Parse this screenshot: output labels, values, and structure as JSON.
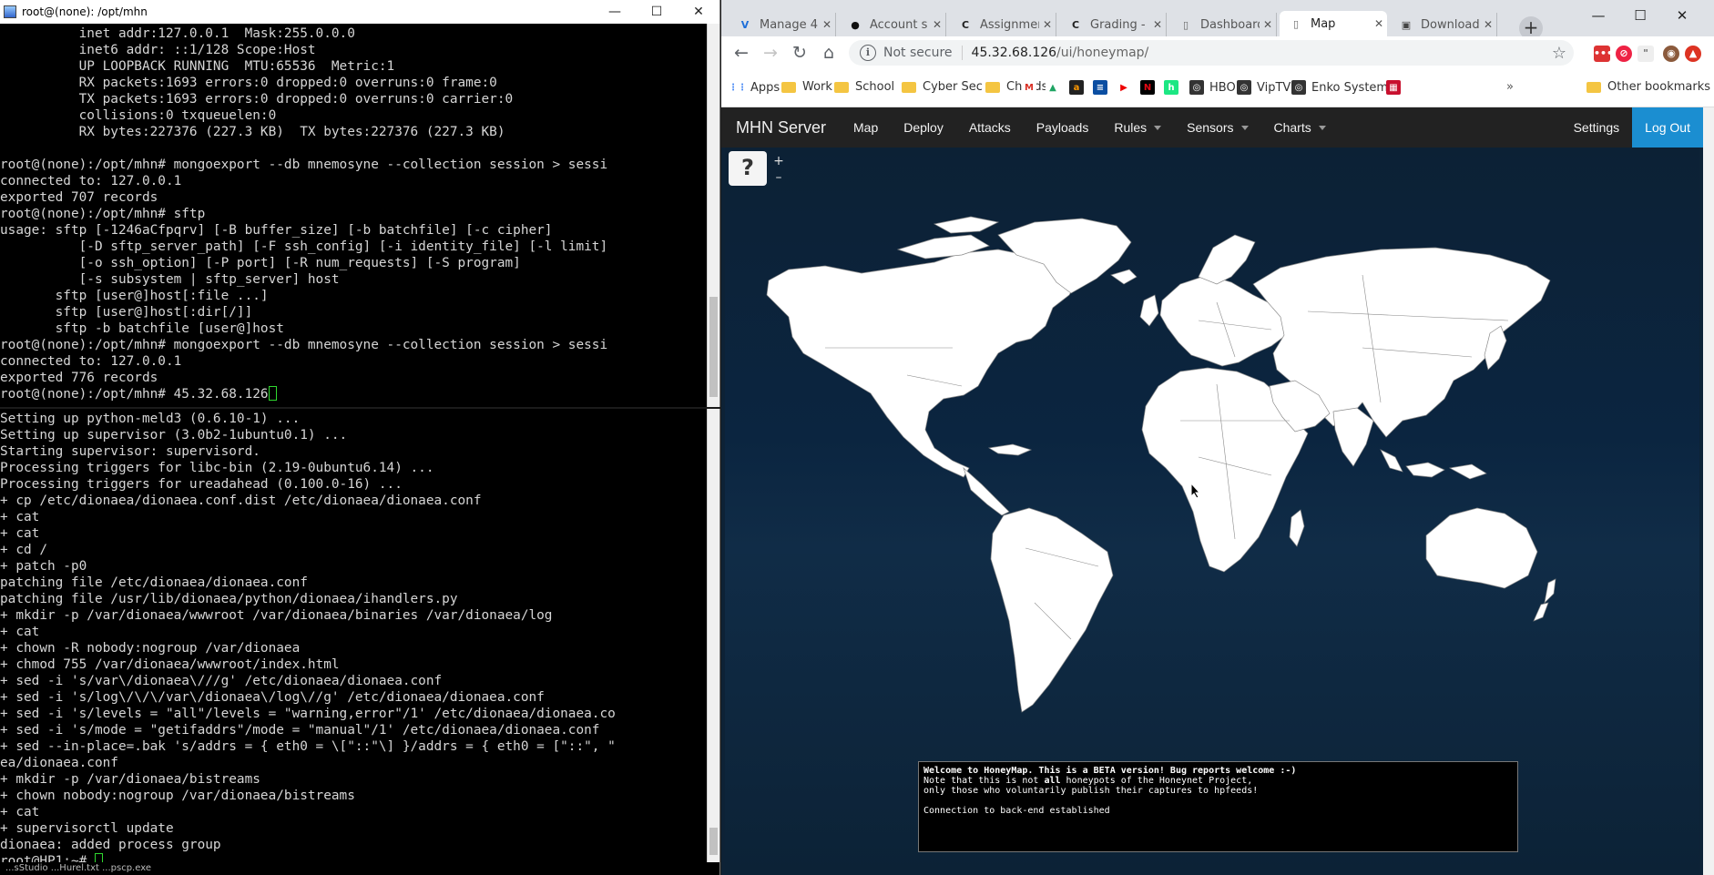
{
  "terminal_top": {
    "title": "root@(none): /opt/mhn",
    "lines": [
      "          inet addr:127.0.0.1  Mask:255.0.0.0",
      "          inet6 addr: ::1/128 Scope:Host",
      "          UP LOOPBACK RUNNING  MTU:65536  Metric:1",
      "          RX packets:1693 errors:0 dropped:0 overruns:0 frame:0",
      "          TX packets:1693 errors:0 dropped:0 overruns:0 carrier:0",
      "          collisions:0 txqueuelen:0",
      "          RX bytes:227376 (227.3 KB)  TX bytes:227376 (227.3 KB)",
      "",
      "root@(none):/opt/mhn# mongoexport --db mnemosyne --collection session > sessi",
      "connected to: 127.0.0.1",
      "exported 707 records",
      "root@(none):/opt/mhn# sftp",
      "usage: sftp [-1246aCfpqrv] [-B buffer_size] [-b batchfile] [-c cipher]",
      "          [-D sftp_server_path] [-F ssh_config] [-i identity_file] [-l limit]",
      "          [-o ssh_option] [-P port] [-R num_requests] [-S program]",
      "          [-s subsystem | sftp_server] host",
      "       sftp [user@]host[:file ...]",
      "       sftp [user@]host[:dir[/]]",
      "       sftp -b batchfile [user@]host",
      "root@(none):/opt/mhn# mongoexport --db mnemosyne --collection session > sessi",
      "connected to: 127.0.0.1",
      "exported 776 records"
    ],
    "prompt": "root@(none):/opt/mhn# 45.32.68.126"
  },
  "terminal_bottom": {
    "lines": [
      "Setting up python-meld3 (0.6.10-1) ...",
      "Setting up supervisor (3.0b2-1ubuntu0.1) ...",
      "Starting supervisor: supervisord.",
      "Processing triggers for libc-bin (2.19-0ubuntu6.14) ...",
      "Processing triggers for ureadahead (0.100.0-16) ...",
      "+ cp /etc/dionaea/dionaea.conf.dist /etc/dionaea/dionaea.conf",
      "+ cat",
      "+ cat",
      "+ cd /",
      "+ patch -p0",
      "patching file /etc/dionaea/dionaea.conf",
      "patching file /usr/lib/dionaea/python/dionaea/ihandlers.py",
      "+ mkdir -p /var/dionaea/wwwroot /var/dionaea/binaries /var/dionaea/log",
      "+ cat",
      "+ chown -R nobody:nogroup /var/dionaea",
      "+ chmod 755 /var/dionaea/wwwroot/index.html",
      "+ sed -i 's/var\\/dionaea\\///g' /etc/dionaea/dionaea.conf",
      "+ sed -i 's/log\\/\\/\\/var\\/dionaea\\/log\\//g' /etc/dionaea/dionaea.conf",
      "+ sed -i 's/levels = \"all\"/levels = \"warning,error\"/1' /etc/dionaea/dionaea.co",
      "+ sed -i 's/mode = \"getifaddrs\"/mode = \"manual\"/1' /etc/dionaea/dionaea.conf",
      "+ sed --in-place=.bak 's/addrs = { eth0 = \\[\"::\"\\] }/addrs = { eth0 = [\"::\", \"",
      "ea/dionaea.conf",
      "+ mkdir -p /var/dionaea/bistreams",
      "+ chown nobody:nogroup /var/dionaea/bistreams",
      "+ cat",
      "+ supervisorctl update",
      "dionaea: added process group"
    ],
    "prompt": "root@HP1:~# ",
    "taskstrip": "...sStudio     ...Hurel.txt       ...pscp.exe"
  },
  "browser": {
    "tabs": [
      {
        "label": "Manage 4",
        "icon": "vultr-icon",
        "glyph": "V",
        "color": "#1e6fd9"
      },
      {
        "label": "Account s",
        "icon": "github-icon",
        "glyph": "●",
        "color": "#111"
      },
      {
        "label": "Assignmen",
        "icon": "canvas-icon",
        "glyph": "C",
        "color": "#222"
      },
      {
        "label": "Grading -",
        "icon": "canvas-icon",
        "glyph": "C",
        "color": "#222"
      },
      {
        "label": "Dashboard",
        "icon": "page-icon",
        "glyph": "▯",
        "color": "#666"
      },
      {
        "label": "Map",
        "icon": "page-icon",
        "glyph": "▯",
        "color": "#666",
        "active": true
      },
      {
        "label": "Download",
        "icon": "download-icon",
        "glyph": "▣",
        "color": "#444"
      }
    ],
    "tab_close": "✕",
    "new_tab": "+",
    "address": {
      "security_label": "Not secure",
      "host": "45.32.68.126",
      "path": "/ui/honeymap/"
    },
    "bookmarks": [
      {
        "label": "Apps",
        "type": "apps"
      },
      {
        "label": "Work",
        "type": "folder"
      },
      {
        "label": "School",
        "type": "folder"
      },
      {
        "label": "Cyber Sec",
        "type": "folder"
      },
      {
        "label": "Chords",
        "type": "folder"
      },
      {
        "label": "",
        "type": "gmail"
      },
      {
        "label": "",
        "type": "drive"
      },
      {
        "label": "",
        "type": "amazon"
      },
      {
        "label": "",
        "type": "bank"
      },
      {
        "label": "",
        "type": "youtube"
      },
      {
        "label": "",
        "type": "netflix"
      },
      {
        "label": "",
        "type": "hulu"
      },
      {
        "label": "HBO",
        "type": "site"
      },
      {
        "label": "VipTV",
        "type": "site"
      },
      {
        "label": "Enko Systems",
        "type": "site"
      },
      {
        "label": "",
        "type": "shop"
      }
    ],
    "bookmarks_more": "»",
    "other_bookmarks": "Other bookmarks"
  },
  "mhn": {
    "brand": "MHN Server",
    "nav": [
      {
        "label": "Map",
        "dropdown": false
      },
      {
        "label": "Deploy",
        "dropdown": false
      },
      {
        "label": "Attacks",
        "dropdown": false
      },
      {
        "label": "Payloads",
        "dropdown": false
      },
      {
        "label": "Rules",
        "dropdown": true
      },
      {
        "label": "Sensors",
        "dropdown": true
      },
      {
        "label": "Charts",
        "dropdown": true
      }
    ],
    "settings": "Settings",
    "logout": "Log Out",
    "help": "?",
    "zoom_in": "+",
    "zoom_out": "–",
    "console": {
      "line1_pre": "Welcome to HoneyMap. This is a BETA version! Bug reports welcome :-)",
      "line2_a": "Note that this is not ",
      "line2_bold": "all",
      "line2_b": " honeypots of the Honeynet Project,",
      "line3": "only those who voluntarily publish their captures to hpfeeds!",
      "line4": "",
      "line5": "Connection to back-end established"
    }
  },
  "colors": {
    "terminal_bg": "#000000",
    "terminal_fg": "#d6d6d6",
    "map_ocean": "#0d2236",
    "land": "#ffffff",
    "nav_bg": "#222222",
    "logout_bg": "#1b8ed1"
  }
}
